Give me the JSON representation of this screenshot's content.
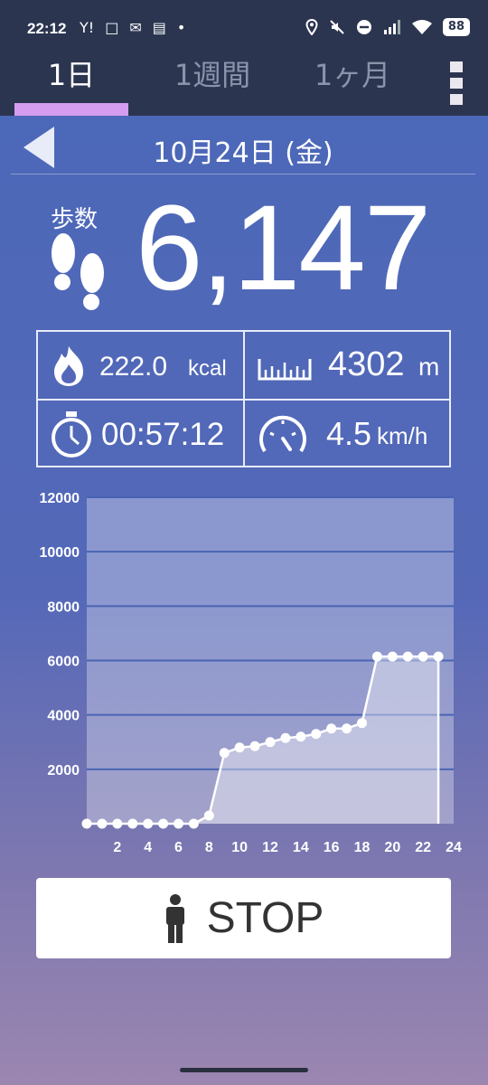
{
  "status_bar": {
    "time": "22:12",
    "left_icons": [
      "Y!",
      "□",
      "✉",
      "▤",
      "•"
    ],
    "battery": "88"
  },
  "tabs": [
    {
      "label": "1日",
      "active": true
    },
    {
      "label": "1週間",
      "active": false
    },
    {
      "label": "1ヶ月",
      "active": false
    }
  ],
  "date": "10月24日 (金)",
  "steps": {
    "label": "歩数",
    "value": "6,147"
  },
  "stats": {
    "calories": {
      "value": "222.0",
      "unit": "kcal"
    },
    "distance": {
      "value": "4302",
      "unit": "m"
    },
    "duration": {
      "value": "00:57:12"
    },
    "speed": {
      "value": "4.5",
      "unit": "km/h"
    }
  },
  "stop_button": {
    "label": "STOP"
  },
  "colors": {
    "accent": "#d59cf0",
    "header": "#2c3550"
  },
  "chart_data": {
    "type": "area",
    "x": [
      0,
      1,
      2,
      3,
      4,
      5,
      6,
      7,
      8,
      9,
      10,
      11,
      12,
      13,
      14,
      15,
      16,
      17,
      18,
      19,
      20,
      21,
      22,
      23
    ],
    "values": [
      0,
      0,
      0,
      0,
      0,
      0,
      0,
      0,
      300,
      2600,
      2800,
      2850,
      3000,
      3150,
      3200,
      3300,
      3500,
      3500,
      3700,
      6147,
      6147,
      6147,
      6147,
      6147
    ],
    "xticks": [
      2,
      4,
      6,
      8,
      10,
      12,
      14,
      16,
      18,
      20,
      22,
      24
    ],
    "yticks": [
      2000,
      4000,
      6000,
      8000,
      10000,
      12000
    ],
    "xlim": [
      0,
      24
    ],
    "ylim": [
      0,
      12000
    ],
    "grid": true,
    "title": "",
    "xlabel": "",
    "ylabel": ""
  }
}
